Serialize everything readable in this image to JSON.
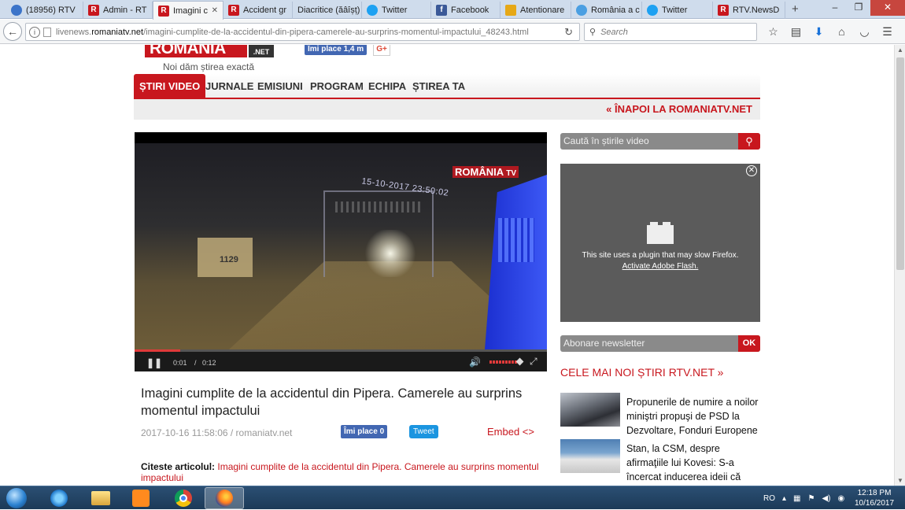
{
  "browser": {
    "tabs": [
      {
        "label": "(18956) RTV",
        "icon": "globe-icon"
      },
      {
        "label": "Admin - RT",
        "icon": "rtv-icon"
      },
      {
        "label": "Imagini c",
        "icon": "rtv-icon",
        "active": true
      },
      {
        "label": "Accident gr",
        "icon": "rtv-icon"
      },
      {
        "label": "Diacritice (ăâîșț)",
        "icon": "none"
      },
      {
        "label": "Twitter",
        "icon": "twitter-icon"
      },
      {
        "label": "Facebook",
        "icon": "facebook-icon"
      },
      {
        "label": "Atentionare",
        "icon": "warning-icon"
      },
      {
        "label": "România a c",
        "icon": "globe-icon"
      },
      {
        "label": "Twitter",
        "icon": "twitter-icon"
      },
      {
        "label": "RTV.NewsD",
        "icon": "rtv-icon"
      }
    ],
    "new_tab": "+",
    "url_prefix": "livenews.",
    "url_host": "romaniatv.net",
    "url_path": "/imagini-cumplite-de-la-accidentul-din-pipera-camerele-au-surprins-momentul-impactului_48243.html",
    "search_placeholder": "Search"
  },
  "site": {
    "logo": "ROMÂNIA",
    "logo_suffix": ".NET",
    "fb_like_top": "Îmi place 1,4 m",
    "gplus": "G+",
    "tagline": "Noi dăm știrea exactă",
    "nav": [
      "ȘTIRI VIDEO",
      "JURNALE",
      "EMISIUNI",
      "PROGRAM",
      "ECHIPA",
      "ȘTIREA TA"
    ],
    "back_link": "« ÎNAPOI LA ROMANIATV.NET"
  },
  "player": {
    "watermark": "ROMÂNIA",
    "watermark_suffix": "TV",
    "timestamp": "15-10-2017 23:50:02",
    "billboard": "1129",
    "current_time": "0:01",
    "separator": "/",
    "duration": "0:12",
    "progress": 0.11,
    "volume": 0.85
  },
  "article": {
    "title": "Imagini cumplite de la accidentul din Pipera. Camerele au surprins momentul impactului",
    "date": "2017-10-16 11:58:06",
    "source": "/ romaniatv.net",
    "fb_like": "Îmi place 0",
    "tweet": "Tweet",
    "embed": "Embed <>",
    "read_label": "Citeste articolul:",
    "read_link": "Imagini cumplite de la accidentul din Pipera. Camerele au surprins momentul impactului"
  },
  "sidebar": {
    "search_placeholder": "Caută în știrile video",
    "flash_message": "This site uses a plugin that may slow Firefox.",
    "flash_link": "Activate Adobe Flash.",
    "newsletter_placeholder": "Abonare newsletter",
    "newsletter_button": "OK",
    "latest_heading": "CELE MAI NOI ȘTIRI RTV.NET »",
    "news": [
      {
        "text": "Propunerile de numire a noilor miniştri propuşi de PSD la Dezvoltare, Fonduri Europene"
      },
      {
        "text": "Stan, la CSM, despre afirmaţiile lui Kovesi: S-a încercat inducerea ideii că inspectorii"
      }
    ]
  },
  "taskbar": {
    "lang": "RO",
    "time": "12:18 PM",
    "date": "10/16/2017"
  },
  "colors": {
    "brand_red": "#c8171e",
    "facebook_blue": "#4267b2",
    "taskbar": "#1c3a58"
  }
}
